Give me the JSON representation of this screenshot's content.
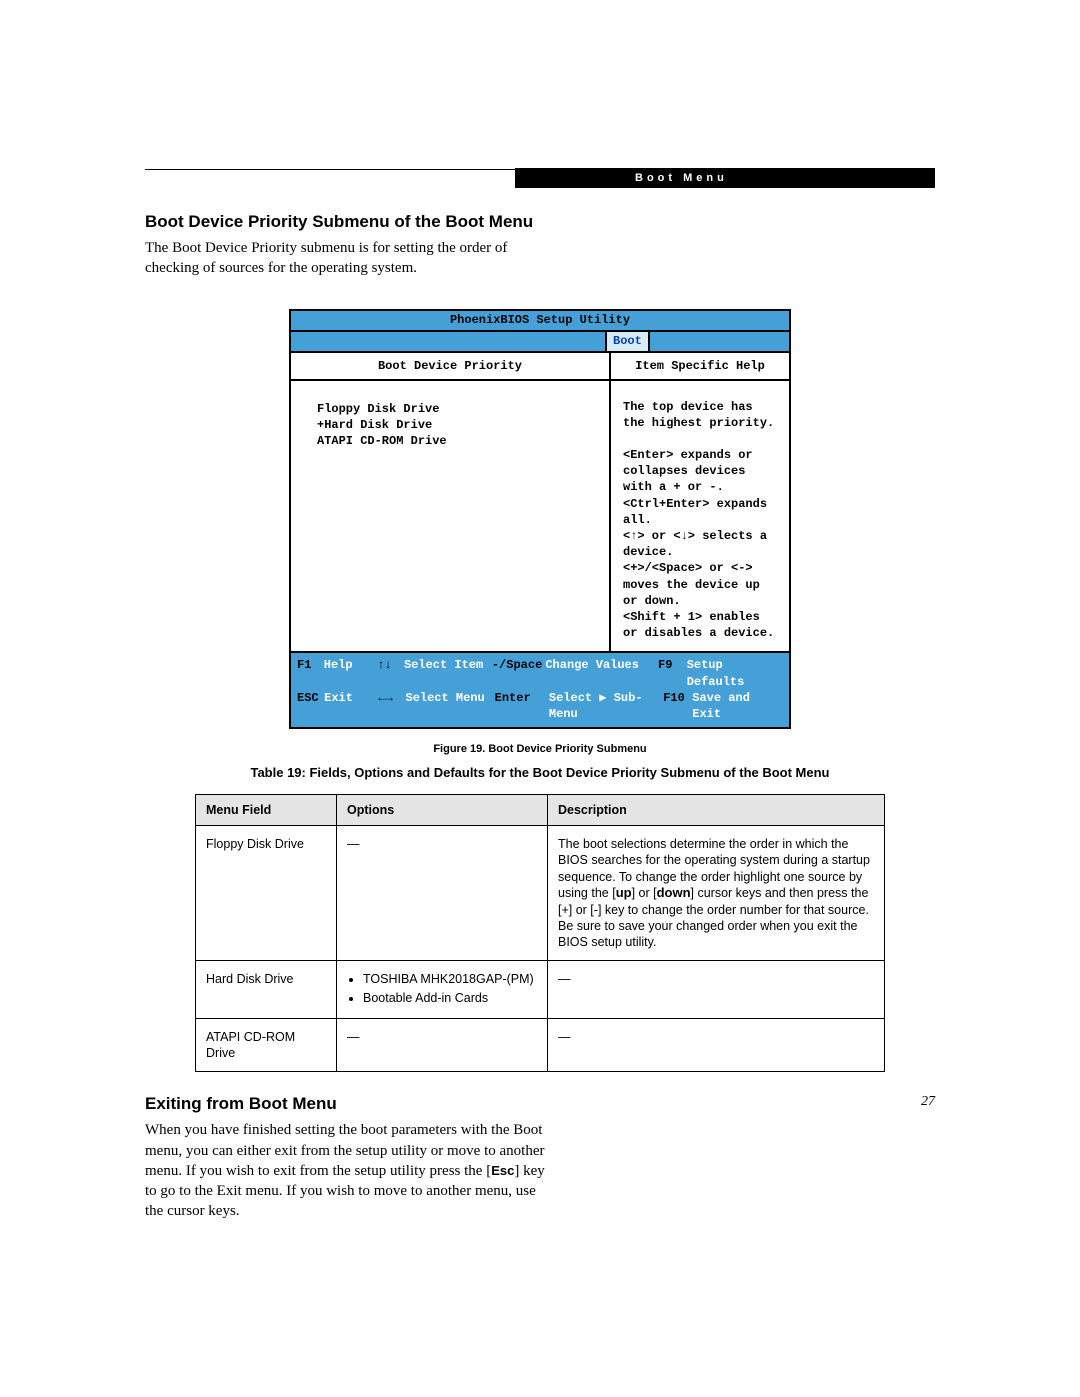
{
  "header": {
    "band": "Boot Menu"
  },
  "section1": {
    "heading": "Boot Device Priority Submenu of the Boot Menu",
    "para": "The Boot Device Priority submenu is for setting the order of checking of sources for the operating system."
  },
  "bios": {
    "title": "PhoenixBIOS Setup Utility",
    "tab": "Boot",
    "left_head": "Boot Device Priority",
    "right_head": "Item Specific Help",
    "devices": [
      " Floppy Disk Drive",
      "+Hard Disk Drive",
      " ATAPI CD-ROM Drive"
    ],
    "help": "The top device has the highest priority.\n\n<Enter> expands or collapses devices with a + or -.\n<Ctrl+Enter> expands all.\n<↑> or <↓> selects a device.\n<+>/<Space> or <-> moves the device up or down.\n<Shift + 1> enables or disables a device.",
    "footer": {
      "r1": {
        "k1": "F1",
        "l1": "Help",
        "k2": "↑↓",
        "l2": "Select Item",
        "k3": "-/Space",
        "l3": "Change Values",
        "k4": "F9",
        "l4": "Setup Defaults"
      },
      "r2": {
        "k1": "ESC",
        "l1": "Exit",
        "k2": "←→",
        "l2": "Select Menu",
        "k3": "Enter",
        "l3": "Select ▶ Sub-Menu",
        "k4": "F10",
        "l4": "Save and Exit"
      }
    }
  },
  "figure_caption": "Figure 19.  Boot Device Priority Submenu",
  "table_caption": "Table 19: Fields, Options and Defaults for the Boot Device Priority Submenu of the Boot Menu",
  "table": {
    "headers": {
      "c1": "Menu Field",
      "c2": "Options",
      "c3": "Description"
    },
    "rows": [
      {
        "menu": "Floppy Disk Drive",
        "options_dash": "—",
        "desc": "The boot selections determine the order in which the BIOS searches for the operating system during a startup sequence. To change the order highlight one source by using the [up] or [down] cursor keys and then press the [+] or [-] key to change the order number for that source. Be sure to save your changed order when you exit the BIOS setup utility.",
        "bold1": "up",
        "bold2": "down"
      },
      {
        "menu": "Hard Disk Drive",
        "options": [
          "TOSHIBA MHK2018GAP-(PM)",
          "Bootable Add-in Cards"
        ],
        "desc_dash": "—"
      },
      {
        "menu": "ATAPI CD-ROM Drive",
        "options_dash": "—",
        "desc_dash": "—"
      }
    ]
  },
  "section2": {
    "heading": "Exiting from Boot Menu",
    "para_pre": "When you have finished setting the boot parameters with the Boot menu, you can either exit from the setup utility or move to another menu. If you wish to exit from the setup utility press the [",
    "esc": "Esc",
    "para_post": "] key to go to the Exit menu. If you wish to move to another menu, use the cursor keys."
  },
  "page_number": "27"
}
